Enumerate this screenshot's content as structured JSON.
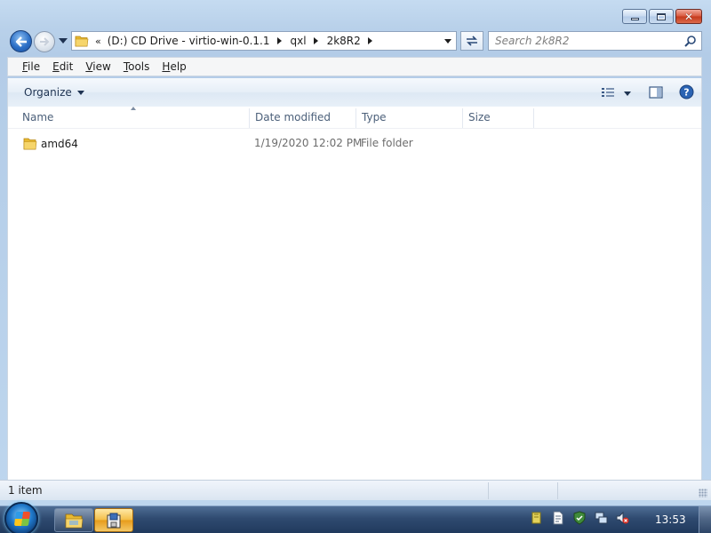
{
  "window": {
    "address": {
      "overflow": "«",
      "crumbs": [
        "(D:) CD Drive - virtio-win-0.1.1",
        "qxl",
        "2k8R2"
      ]
    },
    "search": {
      "placeholder": "Search 2k8R2"
    }
  },
  "menubar": {
    "items": [
      {
        "accel": "F",
        "rest": "ile"
      },
      {
        "accel": "E",
        "rest": "dit"
      },
      {
        "accel": "V",
        "rest": "iew"
      },
      {
        "accel": "T",
        "rest": "ools"
      },
      {
        "accel": "H",
        "rest": "elp"
      }
    ]
  },
  "commandbar": {
    "organize_label": "Organize"
  },
  "list": {
    "columns": [
      "Name",
      "Date modified",
      "Type",
      "Size"
    ],
    "rows": [
      {
        "name": "amd64",
        "date": "1/19/2020 12:02 PM",
        "type": "File folder",
        "size": ""
      }
    ]
  },
  "statusbar": {
    "text": "1 item"
  },
  "taskbar": {
    "clock": "13:53"
  },
  "icons": {
    "back": "back-arrow-icon",
    "forward": "forward-arrow-icon",
    "refresh": "refresh-icon",
    "search": "search-icon",
    "views": "views-icon",
    "preview": "preview-pane-icon",
    "help": "help-icon",
    "folder": "folder-icon"
  },
  "colors": {
    "frame": "#b9d1ea",
    "taskbar": "#2f4a70",
    "active_task": "#f3bd45",
    "close_button": "#d8573d"
  }
}
